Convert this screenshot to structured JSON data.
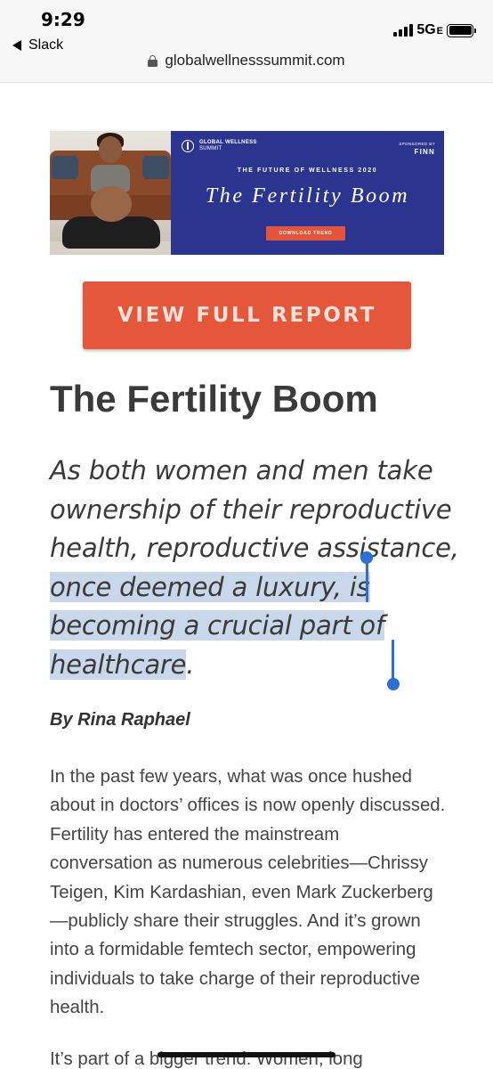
{
  "status_bar": {
    "time": "9:29",
    "back_app": "Slack",
    "network": "5G",
    "network_suffix": "E"
  },
  "browser": {
    "url": "globalwellnesssummit.com"
  },
  "banner": {
    "org_name": "GLOBAL WELLNESS",
    "org_sub": "SUMMIT",
    "sponsor_label": "SPONSORED BY",
    "sponsor_name": "FINN",
    "kicker": "THE FUTURE OF WELLNESS 2020",
    "title": "The Fertility Boom",
    "button": "DOWNLOAD TREND"
  },
  "cta": {
    "label": "VIEW FULL REPORT"
  },
  "article": {
    "title": "The Fertility Boom",
    "subheading_before": "As both women and men take ownership of their reproductive health, reproductive assistance, ",
    "subheading_selected": "once deemed a luxury, is becoming a crucial part of healthcare",
    "subheading_after": ".",
    "byline": "By Rina Raphael",
    "paragraph_1": "In the past few years, what was once hushed about in doctors’ offices is now openly discussed. Fertility has entered the mainstream conversation as numerous celebrities—Chrissy Teigen, Kim Kardashian, even Mark Zuckerberg—publicly share their struggles. And it’s grown into a formidable femtech sector, empowering individuals to take charge of their reproductive health.",
    "paragraph_2_start": "It’s part of a bigger trend: Women, long"
  },
  "colors": {
    "cta": "#e4573a",
    "banner_bg": "#2b3590",
    "selection": "#c9d7ea",
    "selection_handle": "#2e6fd6"
  }
}
